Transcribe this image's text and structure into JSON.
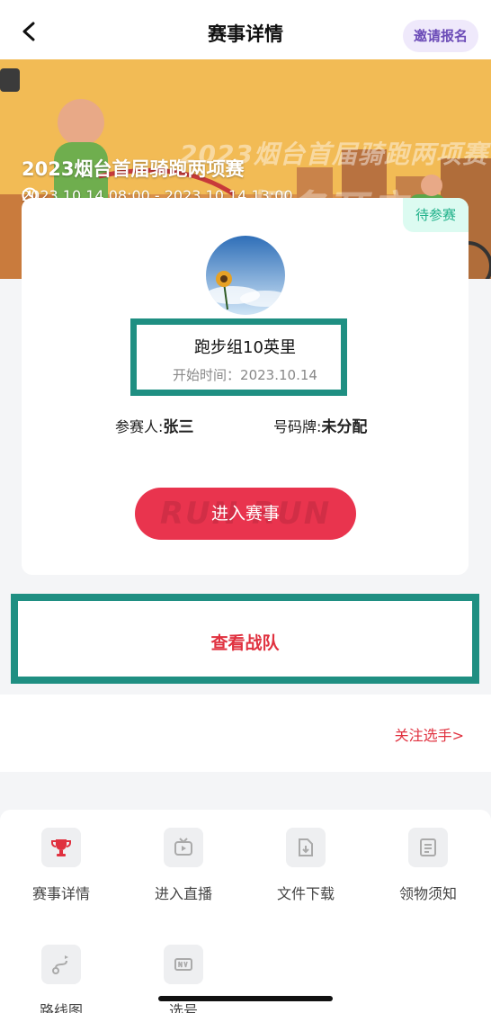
{
  "nav": {
    "title": "赛事详情",
    "invite_label": "邀请报名"
  },
  "banner": {
    "title": "2023烟台首届骑跑两项赛",
    "time": "2023.10.14 08:00 - 2023.10.14 13:00",
    "deco_title": "2023烟台首届骑跑两项赛",
    "deco_sub": "报名开启"
  },
  "card": {
    "status_tag": "待参赛",
    "group_name": "跑步组10英里",
    "start_time": "开始时间：2023.10.14",
    "participant_label": "参赛人:",
    "participant_name": "张三",
    "bib_label": "号码牌:",
    "bib_value": "未分配",
    "enter_button": "进入赛事",
    "enter_watermark": "RUN  RUN"
  },
  "team": {
    "label": "查看战队"
  },
  "follow": {
    "label": "关注选手>"
  },
  "tools": [
    {
      "label": "赛事详情",
      "icon": "trophy-icon"
    },
    {
      "label": "进入直播",
      "icon": "live-tv-icon"
    },
    {
      "label": "文件下载",
      "icon": "file-download-icon"
    },
    {
      "label": "领物须知",
      "icon": "notice-icon"
    },
    {
      "label": "路线图",
      "icon": "route-icon"
    },
    {
      "label": "选号",
      "icon": "number-icon"
    }
  ],
  "colors": {
    "accent_red": "#e9344e",
    "highlight_teal": "#1f8f82",
    "tag_green": "#1fb089"
  }
}
